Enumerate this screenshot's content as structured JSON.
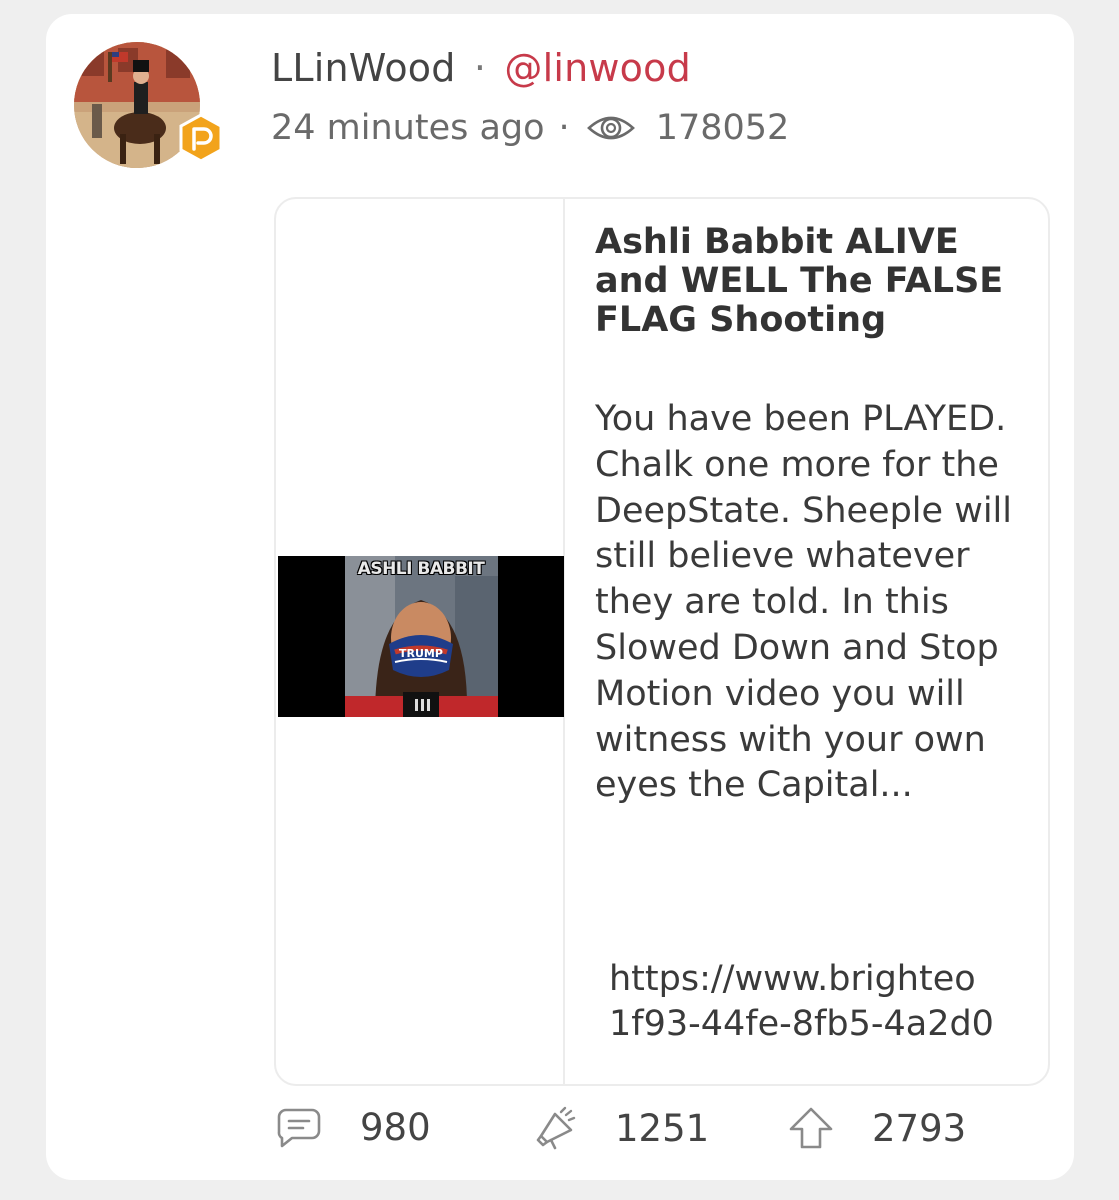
{
  "post": {
    "display_name": "LLinWood",
    "separator": "·",
    "handle": "@linwood",
    "time_ago": "24 minutes ago",
    "views": "178052",
    "avatar_icon": "avatar-image",
    "badge_icon": "parler-badge-icon",
    "accent_color": "#c73a4a",
    "badge_color": "#f2a31b"
  },
  "embed": {
    "thumbnail_caption": "ASHLI BABBIT",
    "thumbnail_mask_text": "TRUMP",
    "title": "Ashli Babbit ALIVE and WELL The FALSE FLAG Shooting",
    "description": "You have been PLAYED. Chalk one more for the DeepState. Sheeple will still believe whatever they are told. In this Slowed Down and Stop Motion video you will witness with your own eyes the Capital...",
    "url_line1": "https://www.brighteo",
    "url_line2": "1f93-44fe-8fb5-4a2d0"
  },
  "actions": {
    "comments": "980",
    "echoes": "1251",
    "upvotes": "2793",
    "comment_icon": "comment-icon",
    "echo_icon": "echo-megaphone-icon",
    "upvote_icon": "upvote-arrow-icon"
  }
}
